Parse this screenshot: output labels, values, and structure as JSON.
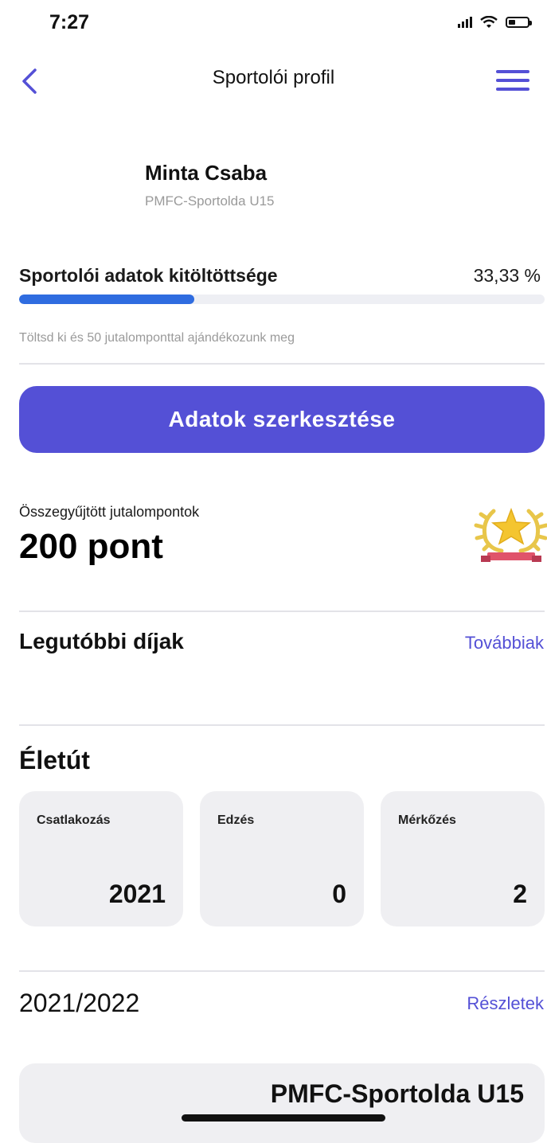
{
  "status_bar": {
    "time": "7:27"
  },
  "header": {
    "title": "Sportolói profil"
  },
  "profile": {
    "name": "Minta Csaba",
    "team": "PMFC-Sportolda U15"
  },
  "completion": {
    "label": "Sportolói adatok kitöltöttsége",
    "value_text": "33,33 %",
    "progress": 0.3333,
    "hint": "Töltsd ki és 50 jutalomponttal ajándékozunk meg"
  },
  "edit_button": {
    "label": "Adatok szerkesztése"
  },
  "points": {
    "label": "Összegyűjtött jutalompontok",
    "value": "200 pont"
  },
  "awards": {
    "title": "Legutóbbi díjak",
    "link": "Továbbiak"
  },
  "career": {
    "title": "Életút",
    "stats": [
      {
        "label": "Csatlakozás",
        "value": "2021"
      },
      {
        "label": "Edzés",
        "value": "0"
      },
      {
        "label": "Mérkőzés",
        "value": "2"
      }
    ]
  },
  "season": {
    "title": "2021/2022",
    "link": "Részletek",
    "team": "PMFC-Sportolda U15"
  },
  "colors": {
    "accent": "#5450d6",
    "progress": "#2f6ce0",
    "card": "#efeff2"
  }
}
